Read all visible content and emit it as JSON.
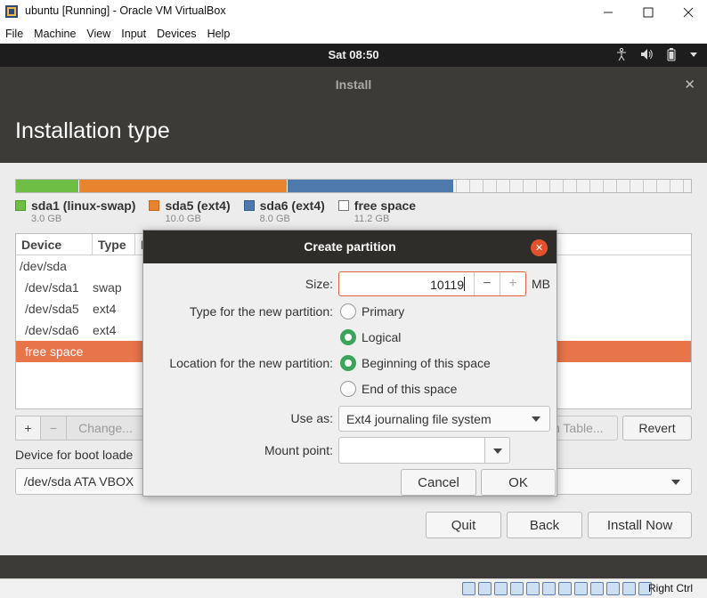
{
  "vbox": {
    "window_title": "ubuntu [Running] - Oracle VM VirtualBox",
    "menu": [
      "File",
      "Machine",
      "View",
      "Input",
      "Devices",
      "Help"
    ],
    "host_key": "Right Ctrl"
  },
  "topbar": {
    "clock": "Sat 08:50"
  },
  "installer": {
    "window_title": "Install",
    "page_title": "Installation type",
    "partition_bar": [
      {
        "color": "#6ebd45",
        "fraction": 0.094
      },
      {
        "color": "#e8842e",
        "fraction": 0.308
      },
      {
        "color": "#4e79ad",
        "fraction": 0.246
      },
      {
        "color": "#f2f2f2",
        "fraction": 0.352
      }
    ],
    "legend": [
      {
        "name": "sda1 (linux-swap)",
        "size": "3.0 GB",
        "color": "#6ebd45"
      },
      {
        "name": "sda5 (ext4)",
        "size": "10.0 GB",
        "color": "#e8842e"
      },
      {
        "name": "sda6 (ext4)",
        "size": "8.0 GB",
        "color": "#4e79ad"
      },
      {
        "name": "free space",
        "size": "11.2 GB",
        "color": "#ffffff"
      }
    ],
    "table": {
      "columns": [
        "Device",
        "Type",
        "M"
      ],
      "rows": [
        {
          "device": "/dev/sda",
          "type": ""
        },
        {
          "device": "/dev/sda1",
          "type": "swap"
        },
        {
          "device": "/dev/sda5",
          "type": "ext4"
        },
        {
          "device": "/dev/sda6",
          "type": "ext4"
        },
        {
          "device": "free space",
          "type": ""
        }
      ]
    },
    "table_buttons": {
      "add": "+",
      "remove": "−",
      "change": "Change...",
      "new_table": "n Table...",
      "revert": "Revert"
    },
    "boot_loader_label": "Device for boot loade",
    "boot_loader_value": "/dev/sda   ATA VBOX",
    "nav": {
      "quit": "Quit",
      "back": "Back",
      "install_now": "Install Now"
    }
  },
  "dialog": {
    "title": "Create partition",
    "size_label": "Size:",
    "size_value": "10119",
    "size_unit": "MB",
    "type_label": "Type for the new partition:",
    "type_primary": "Primary",
    "type_logical": "Logical",
    "location_label": "Location for the new partition:",
    "location_beginning": "Beginning of this space",
    "location_end": "End of this space",
    "use_as_label": "Use as:",
    "use_as_value": "Ext4 journaling file system",
    "mount_label": "Mount point:",
    "mount_value": "",
    "cancel": "Cancel",
    "ok": "OK"
  }
}
